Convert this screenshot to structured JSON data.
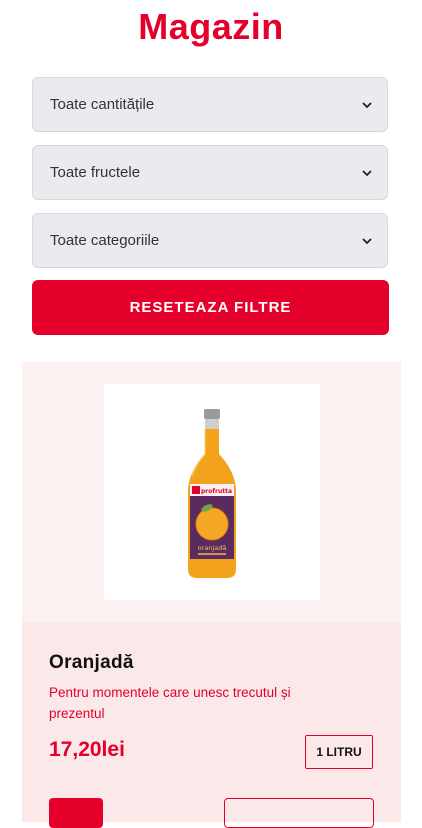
{
  "page": {
    "title": "Magazin"
  },
  "filters": {
    "quantity": {
      "selected": "Toate cantitățile"
    },
    "fruit": {
      "selected": "Toate fructele"
    },
    "category": {
      "selected": "Toate categoriile"
    },
    "reset_label": "RESETEAZA FILTRE"
  },
  "product": {
    "name": "Oranjadă",
    "description": "Pentru momentele care unesc trecutul și prezentul",
    "price": "17,20lei",
    "quantity_badge": "1 LITRU",
    "image": {
      "brand": "profrutta",
      "flavor": "oranjadă"
    }
  },
  "colors": {
    "accent": "#e4002b",
    "select_bg": "#ebebef",
    "card_bg": "#fdf2f2",
    "card_body_bg": "#fbe9ea"
  }
}
